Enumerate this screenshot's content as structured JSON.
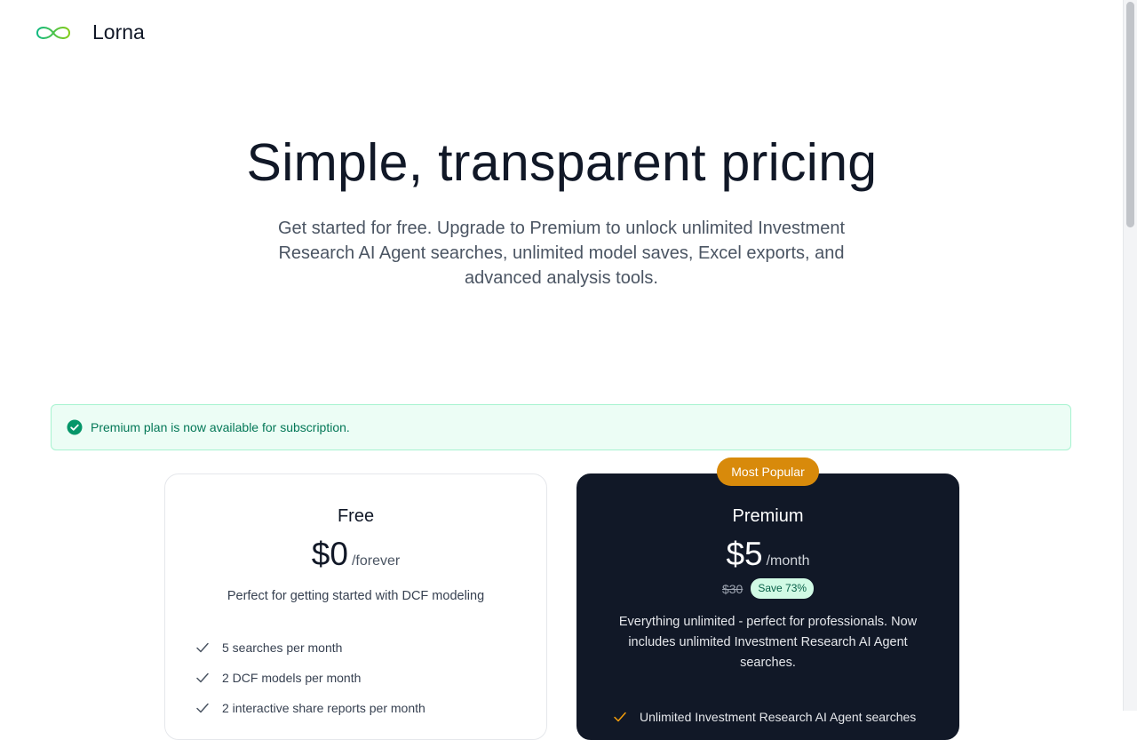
{
  "header": {
    "brand": "Lorna",
    "logo_icon": "infinity-icon"
  },
  "hero": {
    "title": "Simple, transparent pricing",
    "subtitle": "Get started for free. Upgrade to Premium to unlock unlimited Investment Research AI Agent searches, unlimited model saves, Excel exports, and advanced analysis tools."
  },
  "alert": {
    "icon": "check-circle-icon",
    "text": "Premium plan is now available for subscription.",
    "color": "#047857",
    "background": "#ecfdf5"
  },
  "plans": {
    "free": {
      "name": "Free",
      "price": "$0",
      "period": "/forever",
      "description": "Perfect for getting started with DCF modeling",
      "features": [
        "5 searches per month",
        "2 DCF models per month",
        "2 interactive share reports per month"
      ]
    },
    "premium": {
      "badge": "Most Popular",
      "name": "Premium",
      "price": "$5",
      "period": "/month",
      "old_price": "$30",
      "save_label": "Save 73%",
      "description": "Everything unlimited - perfect for professionals. Now includes unlimited Investment Research AI Agent searches.",
      "features": [
        "Unlimited Investment Research AI Agent searches"
      ],
      "background": "#111827",
      "badge_color": "#d88a0b"
    }
  }
}
